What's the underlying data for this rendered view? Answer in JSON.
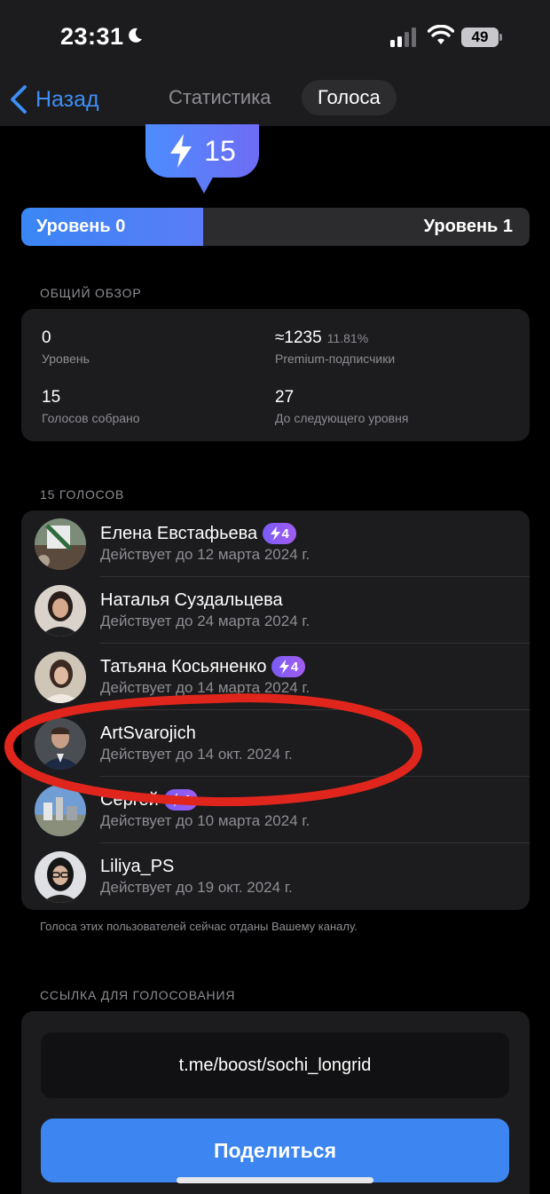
{
  "status_bar": {
    "time": "23:31",
    "battery": "49"
  },
  "nav": {
    "back_label": "Назад",
    "tabs": [
      {
        "label": "Статистика",
        "active": false
      },
      {
        "label": "Голоса",
        "active": true
      }
    ]
  },
  "boost": {
    "count": "15",
    "level_current": "Уровень 0",
    "level_next": "Уровень 1",
    "progress_fraction": 0.357
  },
  "overview": {
    "heading": "ОБЩИЙ ОБЗОР",
    "level_value": "0",
    "level_label": "Уровень",
    "premium_value": "≈1235",
    "premium_percent": "11.81%",
    "premium_label": "Premium-подписчики",
    "votes_value": "15",
    "votes_label": "Голосов собрано",
    "next_value": "27",
    "next_label": "До следующего уровня"
  },
  "voters": {
    "heading": "15 ГОЛОСОВ",
    "items": [
      {
        "name": "Елена Евстафьева",
        "badge": "4",
        "expiry": "Действует до 12 марта 2024 г."
      },
      {
        "name": "Наталья Суздальцева",
        "badge": "",
        "expiry": "Действует до 24 марта 2024 г."
      },
      {
        "name": "Татьяна Косьяненко",
        "badge": "4",
        "expiry": "Действует до 14 марта 2024 г."
      },
      {
        "name": "ArtSvarojich",
        "badge": "",
        "expiry": "Действует до 14 окт. 2024 г."
      },
      {
        "name": "Сергей",
        "badge": "4",
        "expiry": "Действует до 10 марта 2024 г."
      },
      {
        "name": "Liliya_PS",
        "badge": "",
        "expiry": "Действует до 19 окт. 2024 г."
      }
    ],
    "note": "Голоса этих пользователей сейчас отданы Вашему каналу."
  },
  "link": {
    "heading": "ССЫЛКА ДЛЯ ГОЛОСОВАНИЯ",
    "url": "t.me/boost/sochi_longrid",
    "share_label": "Поделиться"
  },
  "colors": {
    "accent": "#3d85f0",
    "boost_gradient_start": "#7a5cf5",
    "annotation": "#e0261c"
  }
}
